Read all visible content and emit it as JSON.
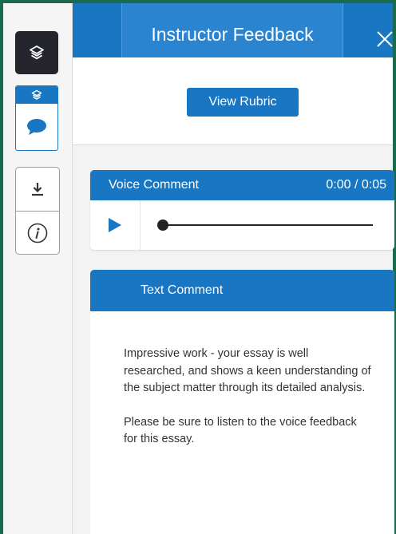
{
  "header": {
    "title": "Instructor Feedback"
  },
  "sidebar": {
    "items": [
      {
        "icon": "layers-icon",
        "active": true
      },
      {
        "icon": "layers-icon",
        "active": false
      },
      {
        "icon": "comment-icon",
        "active": false
      },
      {
        "icon": "download-icon",
        "active": false
      },
      {
        "icon": "info-icon",
        "active": false
      }
    ]
  },
  "rubric": {
    "button_label": "View Rubric"
  },
  "voice_comment": {
    "title": "Voice Comment",
    "time": "0:00 / 0:05",
    "progress": 0
  },
  "text_comment": {
    "title": "Text Comment",
    "paragraphs": [
      "Impressive work - your essay is well researched, and shows a keen understanding of the subject matter through its detailed analysis.",
      "Please be sure to listen to the voice feedback for this essay."
    ]
  },
  "colors": {
    "primary": "#1976c2",
    "frame": "#1a6b4e",
    "dark_button": "#25262d"
  }
}
